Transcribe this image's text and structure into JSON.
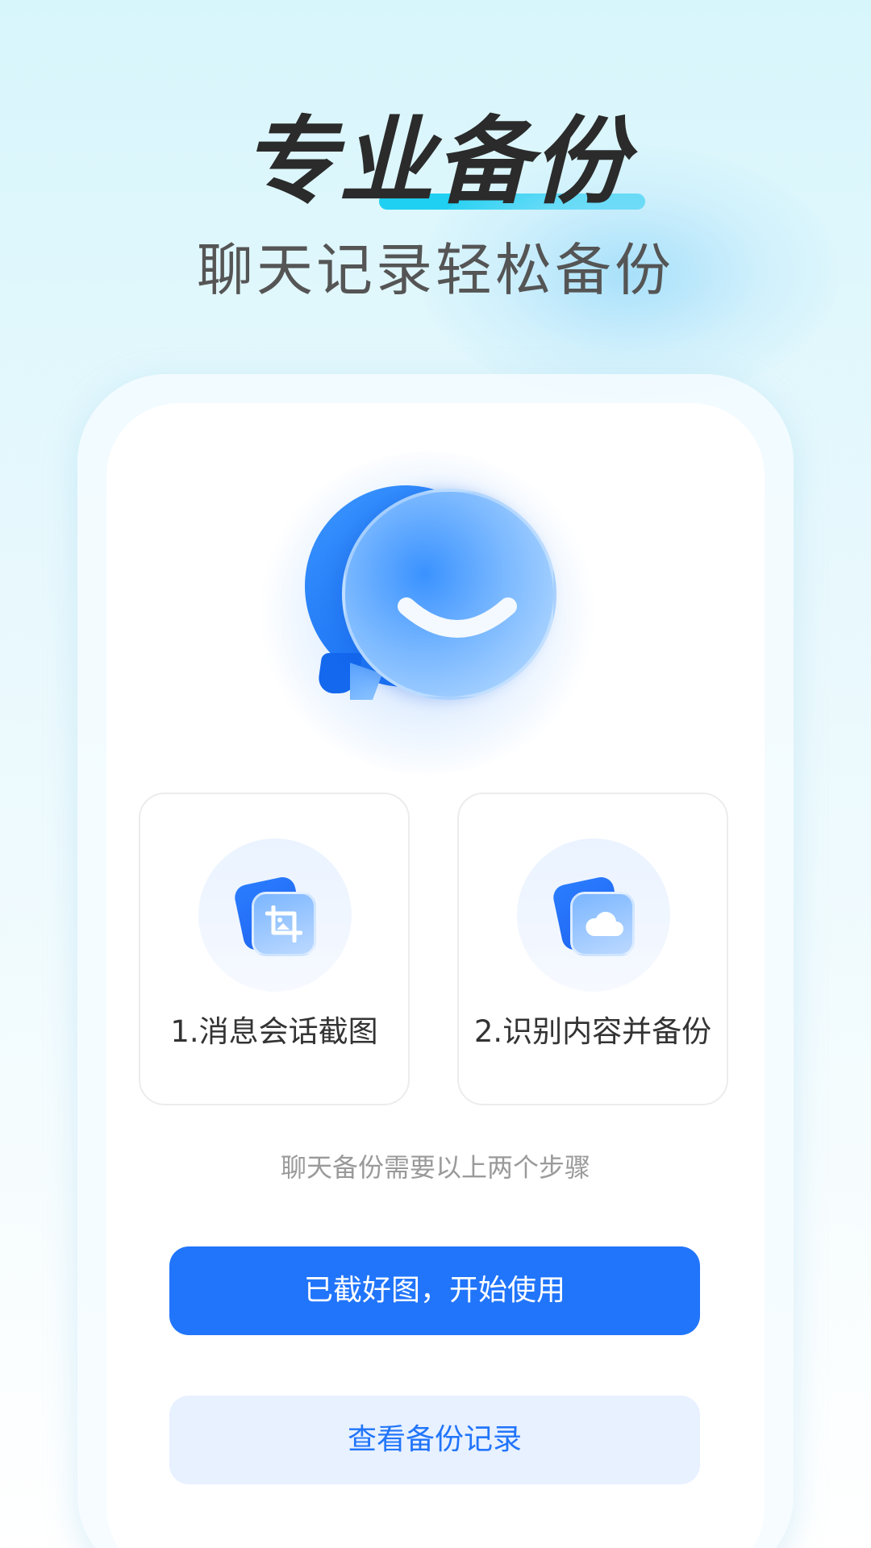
{
  "header": {
    "title": "专业备份",
    "subtitle": "聊天记录轻松备份"
  },
  "logo": {
    "icon": "chat-bubble-smile-icon"
  },
  "steps": [
    {
      "label": "1.消息会话截图",
      "icon": "screenshot-crop-icon"
    },
    {
      "label": "2.识别内容并备份",
      "icon": "cloud-icon"
    }
  ],
  "hint": "聊天备份需要以上两个步骤",
  "actions": {
    "primary_label": "已截好图，开始使用",
    "secondary_label": "查看备份记录"
  },
  "colors": {
    "accent": "#2175fb",
    "title_underline": "#20d0f2",
    "secondary_bg": "#e8f1ff"
  }
}
